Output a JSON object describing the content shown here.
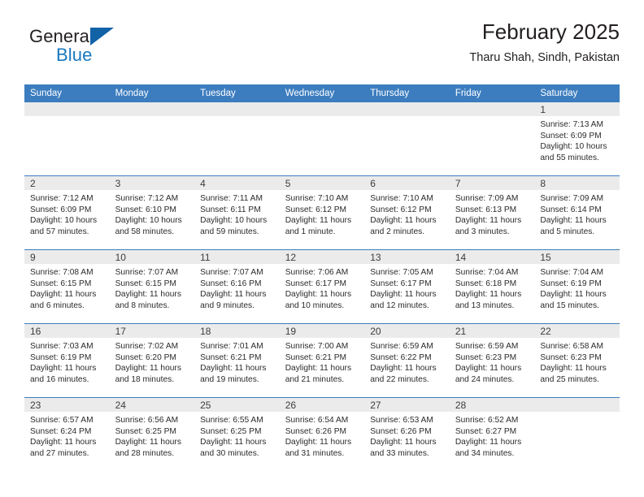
{
  "brand": {
    "word_general": "General",
    "word_blue": "Blue",
    "mark_icon": "triangle-logo-icon"
  },
  "header": {
    "title": "February 2025",
    "subtitle": "Tharu Shah, Sindh, Pakistan",
    "accent_color": "#3c7dbf",
    "brand_blue_color": "#1879bf",
    "band_color": "#ebebeb"
  },
  "calendar": {
    "weekday_headers": [
      "Sunday",
      "Monday",
      "Tuesday",
      "Wednesday",
      "Thursday",
      "Friday",
      "Saturday"
    ],
    "weeks": [
      [
        {
          "blank": true
        },
        {
          "blank": true
        },
        {
          "blank": true
        },
        {
          "blank": true
        },
        {
          "blank": true
        },
        {
          "blank": true
        },
        {
          "day": "1",
          "sunrise": "Sunrise: 7:13 AM",
          "sunset": "Sunset: 6:09 PM",
          "daylight1": "Daylight: 10 hours",
          "daylight2": "and 55 minutes."
        }
      ],
      [
        {
          "day": "2",
          "sunrise": "Sunrise: 7:12 AM",
          "sunset": "Sunset: 6:09 PM",
          "daylight1": "Daylight: 10 hours",
          "daylight2": "and 57 minutes."
        },
        {
          "day": "3",
          "sunrise": "Sunrise: 7:12 AM",
          "sunset": "Sunset: 6:10 PM",
          "daylight1": "Daylight: 10 hours",
          "daylight2": "and 58 minutes."
        },
        {
          "day": "4",
          "sunrise": "Sunrise: 7:11 AM",
          "sunset": "Sunset: 6:11 PM",
          "daylight1": "Daylight: 10 hours",
          "daylight2": "and 59 minutes."
        },
        {
          "day": "5",
          "sunrise": "Sunrise: 7:10 AM",
          "sunset": "Sunset: 6:12 PM",
          "daylight1": "Daylight: 11 hours",
          "daylight2": "and 1 minute."
        },
        {
          "day": "6",
          "sunrise": "Sunrise: 7:10 AM",
          "sunset": "Sunset: 6:12 PM",
          "daylight1": "Daylight: 11 hours",
          "daylight2": "and 2 minutes."
        },
        {
          "day": "7",
          "sunrise": "Sunrise: 7:09 AM",
          "sunset": "Sunset: 6:13 PM",
          "daylight1": "Daylight: 11 hours",
          "daylight2": "and 3 minutes."
        },
        {
          "day": "8",
          "sunrise": "Sunrise: 7:09 AM",
          "sunset": "Sunset: 6:14 PM",
          "daylight1": "Daylight: 11 hours",
          "daylight2": "and 5 minutes."
        }
      ],
      [
        {
          "day": "9",
          "sunrise": "Sunrise: 7:08 AM",
          "sunset": "Sunset: 6:15 PM",
          "daylight1": "Daylight: 11 hours",
          "daylight2": "and 6 minutes."
        },
        {
          "day": "10",
          "sunrise": "Sunrise: 7:07 AM",
          "sunset": "Sunset: 6:15 PM",
          "daylight1": "Daylight: 11 hours",
          "daylight2": "and 8 minutes."
        },
        {
          "day": "11",
          "sunrise": "Sunrise: 7:07 AM",
          "sunset": "Sunset: 6:16 PM",
          "daylight1": "Daylight: 11 hours",
          "daylight2": "and 9 minutes."
        },
        {
          "day": "12",
          "sunrise": "Sunrise: 7:06 AM",
          "sunset": "Sunset: 6:17 PM",
          "daylight1": "Daylight: 11 hours",
          "daylight2": "and 10 minutes."
        },
        {
          "day": "13",
          "sunrise": "Sunrise: 7:05 AM",
          "sunset": "Sunset: 6:17 PM",
          "daylight1": "Daylight: 11 hours",
          "daylight2": "and 12 minutes."
        },
        {
          "day": "14",
          "sunrise": "Sunrise: 7:04 AM",
          "sunset": "Sunset: 6:18 PM",
          "daylight1": "Daylight: 11 hours",
          "daylight2": "and 13 minutes."
        },
        {
          "day": "15",
          "sunrise": "Sunrise: 7:04 AM",
          "sunset": "Sunset: 6:19 PM",
          "daylight1": "Daylight: 11 hours",
          "daylight2": "and 15 minutes."
        }
      ],
      [
        {
          "day": "16",
          "sunrise": "Sunrise: 7:03 AM",
          "sunset": "Sunset: 6:19 PM",
          "daylight1": "Daylight: 11 hours",
          "daylight2": "and 16 minutes."
        },
        {
          "day": "17",
          "sunrise": "Sunrise: 7:02 AM",
          "sunset": "Sunset: 6:20 PM",
          "daylight1": "Daylight: 11 hours",
          "daylight2": "and 18 minutes."
        },
        {
          "day": "18",
          "sunrise": "Sunrise: 7:01 AM",
          "sunset": "Sunset: 6:21 PM",
          "daylight1": "Daylight: 11 hours",
          "daylight2": "and 19 minutes."
        },
        {
          "day": "19",
          "sunrise": "Sunrise: 7:00 AM",
          "sunset": "Sunset: 6:21 PM",
          "daylight1": "Daylight: 11 hours",
          "daylight2": "and 21 minutes."
        },
        {
          "day": "20",
          "sunrise": "Sunrise: 6:59 AM",
          "sunset": "Sunset: 6:22 PM",
          "daylight1": "Daylight: 11 hours",
          "daylight2": "and 22 minutes."
        },
        {
          "day": "21",
          "sunrise": "Sunrise: 6:59 AM",
          "sunset": "Sunset: 6:23 PM",
          "daylight1": "Daylight: 11 hours",
          "daylight2": "and 24 minutes."
        },
        {
          "day": "22",
          "sunrise": "Sunrise: 6:58 AM",
          "sunset": "Sunset: 6:23 PM",
          "daylight1": "Daylight: 11 hours",
          "daylight2": "and 25 minutes."
        }
      ],
      [
        {
          "day": "23",
          "sunrise": "Sunrise: 6:57 AM",
          "sunset": "Sunset: 6:24 PM",
          "daylight1": "Daylight: 11 hours",
          "daylight2": "and 27 minutes."
        },
        {
          "day": "24",
          "sunrise": "Sunrise: 6:56 AM",
          "sunset": "Sunset: 6:25 PM",
          "daylight1": "Daylight: 11 hours",
          "daylight2": "and 28 minutes."
        },
        {
          "day": "25",
          "sunrise": "Sunrise: 6:55 AM",
          "sunset": "Sunset: 6:25 PM",
          "daylight1": "Daylight: 11 hours",
          "daylight2": "and 30 minutes."
        },
        {
          "day": "26",
          "sunrise": "Sunrise: 6:54 AM",
          "sunset": "Sunset: 6:26 PM",
          "daylight1": "Daylight: 11 hours",
          "daylight2": "and 31 minutes."
        },
        {
          "day": "27",
          "sunrise": "Sunrise: 6:53 AM",
          "sunset": "Sunset: 6:26 PM",
          "daylight1": "Daylight: 11 hours",
          "daylight2": "and 33 minutes."
        },
        {
          "day": "28",
          "sunrise": "Sunrise: 6:52 AM",
          "sunset": "Sunset: 6:27 PM",
          "daylight1": "Daylight: 11 hours",
          "daylight2": "and 34 minutes."
        },
        {
          "blank": true
        }
      ]
    ]
  }
}
